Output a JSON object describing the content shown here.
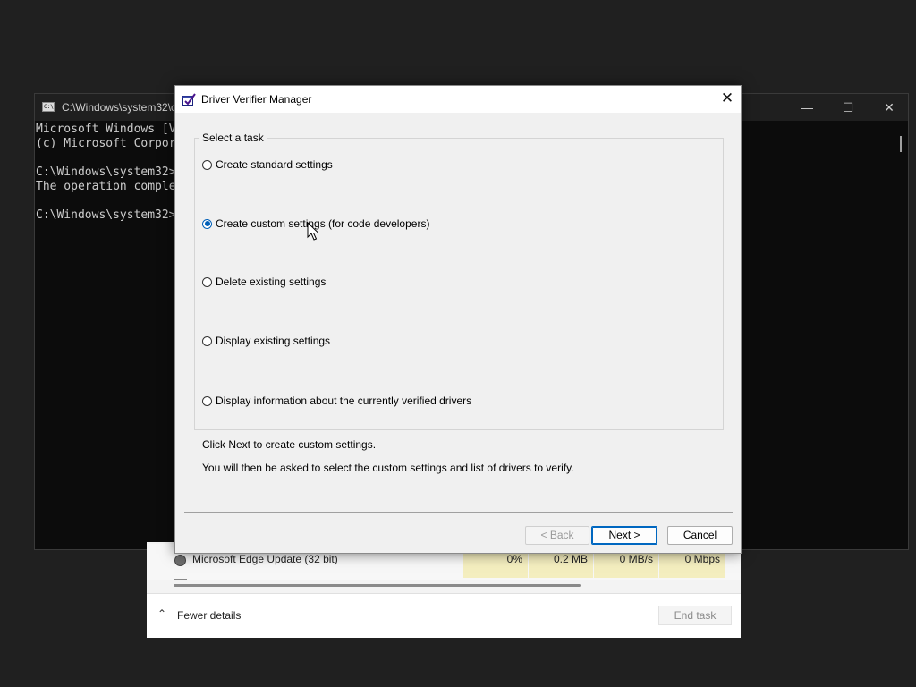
{
  "cmd": {
    "title": "C:\\Windows\\system32\\c",
    "lines": [
      "Microsoft Windows [V",
      "(c) Microsoft Corpor",
      "",
      "C:\\Windows\\system32>",
      "The operation comple",
      "",
      "C:\\Windows\\system32>"
    ],
    "icon_text": "C:\\."
  },
  "taskmgr": {
    "process_name": "Microsoft Edge Update (32 bit)",
    "cpu": "0%",
    "memory": "0.2 MB",
    "disk": "0 MB/s",
    "network": "0 Mbps",
    "fewer_details": "Fewer details",
    "end_task": "End task"
  },
  "dialog": {
    "title": "Driver Verifier Manager",
    "group_label": "Select a task",
    "options": [
      {
        "label": "Create standard settings",
        "selected": false
      },
      {
        "label": "Create custom settings (for code developers)",
        "selected": true
      },
      {
        "label": "Delete existing settings",
        "selected": false
      },
      {
        "label": "Display existing settings",
        "selected": false
      },
      {
        "label": "Display information about the currently verified drivers",
        "selected": false
      }
    ],
    "info_line1": "Click Next to create custom settings.",
    "info_line2": "You will then be asked to select the custom settings and list of drivers to verify.",
    "buttons": {
      "back": "< Back",
      "next": "Next >",
      "cancel": "Cancel"
    }
  },
  "colors": {
    "accent": "#005fb8",
    "highlight_cells": "#f4eebf"
  }
}
